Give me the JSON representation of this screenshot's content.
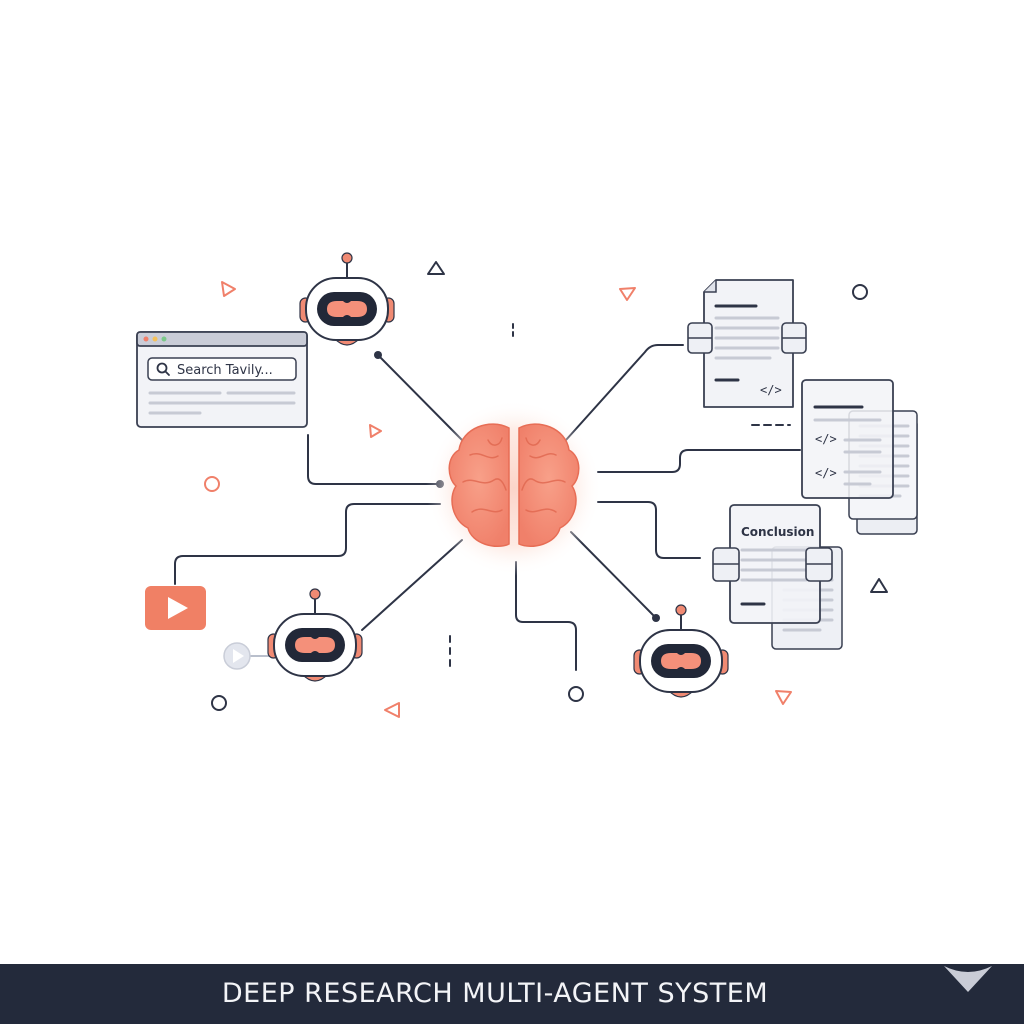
{
  "search_window": {
    "search_text": "Search Tavily..."
  },
  "documents": {
    "code_tag": "</>",
    "conclusion_label": "Conclusion"
  },
  "banner": {
    "title": "DEEP RESEARCH MULTI-AGENT SYSTEM"
  },
  "colors": {
    "accent": "#f07f6a",
    "accent_light": "#fbd2c6",
    "line": "#2e3446",
    "paper": "#f2f3f7",
    "banner": "#232a3b"
  },
  "icons": [
    "brain-icon",
    "robot-icon",
    "browser-window-icon",
    "search-icon",
    "play-button-icon",
    "document-icon",
    "code-tag-icon",
    "gem-logo-icon"
  ]
}
